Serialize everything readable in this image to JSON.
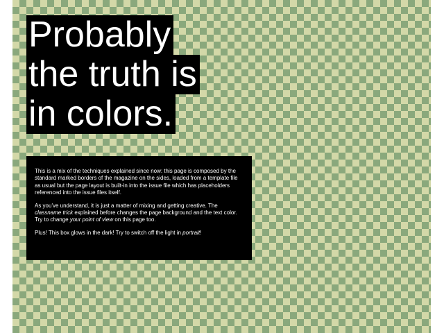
{
  "headline": {
    "line1": "Probably",
    "line2": "the truth is",
    "line3": "in colors."
  },
  "textbox": {
    "p1": "This is a mix of the techniques explained since now: this page is composed by the standard marked borders of the magazine on the sides, loaded from a template file as usual but the page layout is built-in into the issue file which has placeholders referenced into the issue files itself.",
    "p2_a": "As you've understand, it is just a matter of mixing and getting creative. The ",
    "p2_em1": "classname trick",
    "p2_b": " explained before changes the page background and the text color. Try to change ",
    "p2_em2": "your point of view",
    "p2_c": " on this page too.",
    "p3_a": "Plus! This box glows in the dark! Try to switch off the light in ",
    "p3_em": "portrait",
    "p3_b": "!"
  },
  "colors": {
    "check_light": "#d3d8a8",
    "check_dark": "#8aa87c",
    "box_background": "#000000",
    "text": "#ffffff"
  }
}
